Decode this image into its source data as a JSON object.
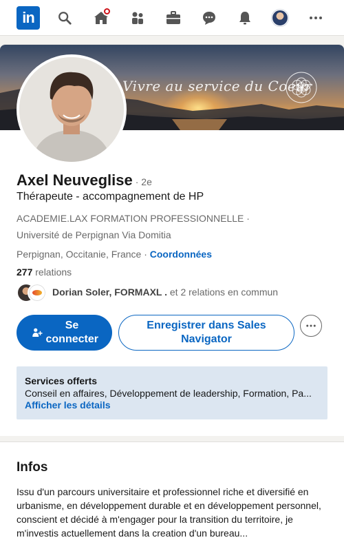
{
  "nav": {
    "logo_text": "in",
    "icons": [
      "linkedin-logo",
      "search-icon",
      "home-icon",
      "people-icon",
      "briefcase-icon",
      "messaging-icon",
      "bell-icon",
      "me-avatar",
      "more-icon"
    ],
    "home_badge_color": "#cc1016"
  },
  "banner": {
    "script_text": "Vivre au service du Coeur"
  },
  "profile": {
    "name": "Axel Neuveglise",
    "degree": "· 2e",
    "headline": "Thérapeute - accompagnement de HP",
    "company": "ACADEMIE.LAX FORMATION PROFESSIONNELLE ·",
    "school": "Université de Perpignan Via Domitia",
    "location": "Perpignan, Occitanie, France ·",
    "contact_link": "Coordonnées",
    "relations_count": "277",
    "relations_label": "relations",
    "mutual_names": "Dorian Soler, FORMAXL .",
    "mutual_rest": "et 2 relations en commun"
  },
  "actions": {
    "connect_label": "Se connecter",
    "sales_nav_label": "Enregistrer dans Sales Navigator"
  },
  "services": {
    "title": "Services offerts",
    "list": "Conseil en affaires, Développement de leadership, Formation, Pa...",
    "link": "Afficher les détails"
  },
  "infos": {
    "title": "Infos",
    "text": "Issu d'un parcours universitaire et professionnel riche et diversifié en urbanisme, en développement durable et en développement personnel, conscient et décidé à m'engager pour la transition du territoire, je m'investis actuellement dans la creation d'un bureau..."
  },
  "colors": {
    "brand": "#0a66c2",
    "services_bg": "#dce6f1",
    "page_bg": "#f3f2ef"
  }
}
